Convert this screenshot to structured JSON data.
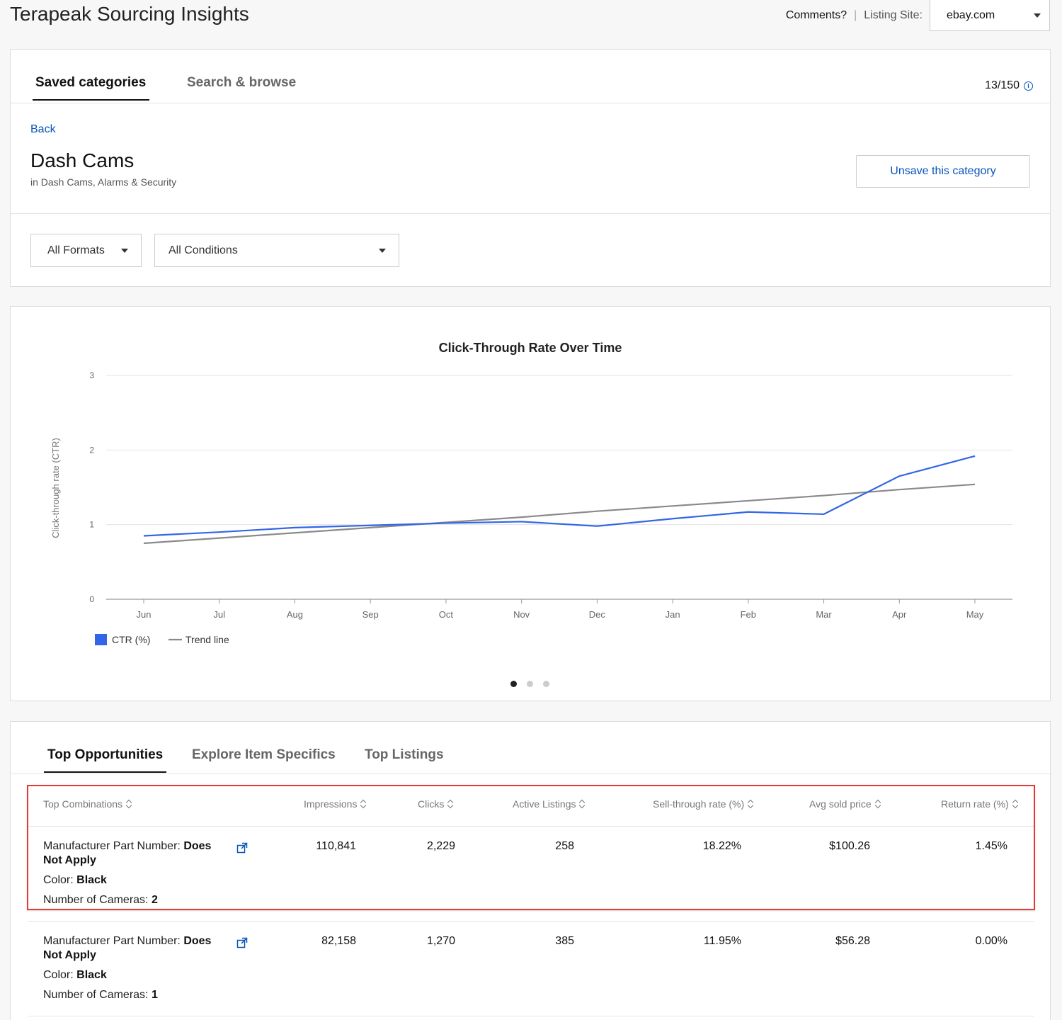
{
  "header": {
    "app_title": "Terapeak Sourcing Insights",
    "comments": "Comments?",
    "separator": "|",
    "listing_site_label": "Listing Site:",
    "listing_site_value": "ebay.com"
  },
  "category_panel": {
    "tabs": [
      "Saved categories",
      "Search & browse"
    ],
    "active_tab": "Saved categories",
    "count": "13/150",
    "back_label": "Back",
    "category_title": "Dash Cams",
    "category_path": "in Dash Cams, Alarms & Security",
    "unsave_label": "Unsave this category",
    "format_filter": "All Formats",
    "condition_filter": "All Conditions"
  },
  "chart_data": {
    "type": "line",
    "title": "Click-Through Rate Over Time",
    "ylabel": "Click-through rate (CTR)",
    "xlabel": "",
    "ylim": [
      0,
      3
    ],
    "yticks": [
      "0",
      "1",
      "2",
      "3"
    ],
    "categories": [
      "Jun",
      "Jul",
      "Aug",
      "Sep",
      "Oct",
      "Nov",
      "Dec",
      "Jan",
      "Feb",
      "Mar",
      "Apr",
      "May"
    ],
    "series": [
      {
        "name": "CTR (%)",
        "color": "#3366e6",
        "values": [
          0.85,
          0.9,
          0.96,
          0.99,
          1.02,
          1.04,
          0.98,
          1.08,
          1.17,
          1.14,
          1.65,
          1.92
        ]
      },
      {
        "name": "Trend line",
        "color": "#8a8a8a",
        "values": [
          0.75,
          0.82,
          0.89,
          0.96,
          1.03,
          1.1,
          1.18,
          1.25,
          1.32,
          1.39,
          1.47,
          1.54
        ]
      }
    ],
    "legend_position": "bottom-left",
    "grid": true
  },
  "carousel": {
    "count": 3,
    "active": 0
  },
  "results_panel": {
    "tabs": [
      "Top Opportunities",
      "Explore Item Specifics",
      "Top Listings"
    ],
    "active_tab": "Top Opportunities",
    "columns": [
      "Top Combinations",
      "Impressions",
      "Clicks",
      "Active Listings",
      "Sell-through rate (%)",
      "Avg sold price",
      "Return rate (%)"
    ],
    "rows": [
      {
        "attrs": [
          {
            "label": "Manufacturer Part Number:",
            "value": "Does Not Apply"
          },
          {
            "label": "Color:",
            "value": "Black"
          },
          {
            "label": "Number of Cameras:",
            "value": "2"
          }
        ],
        "impressions": "110,841",
        "clicks": "2,229",
        "active_listings": "258",
        "sell_through": "18.22%",
        "avg_price": "$100.26",
        "return_rate": "1.45%"
      },
      {
        "attrs": [
          {
            "label": "Manufacturer Part Number:",
            "value": "Does Not Apply"
          },
          {
            "label": "Color:",
            "value": "Black"
          },
          {
            "label": "Number of Cameras:",
            "value": "1"
          }
        ],
        "impressions": "82,158",
        "clicks": "1,270",
        "active_listings": "385",
        "sell_through": "11.95%",
        "avg_price": "$56.28",
        "return_rate": "0.00%"
      }
    ],
    "highlight_color": "#e53935",
    "link_color": "#0654ba"
  }
}
